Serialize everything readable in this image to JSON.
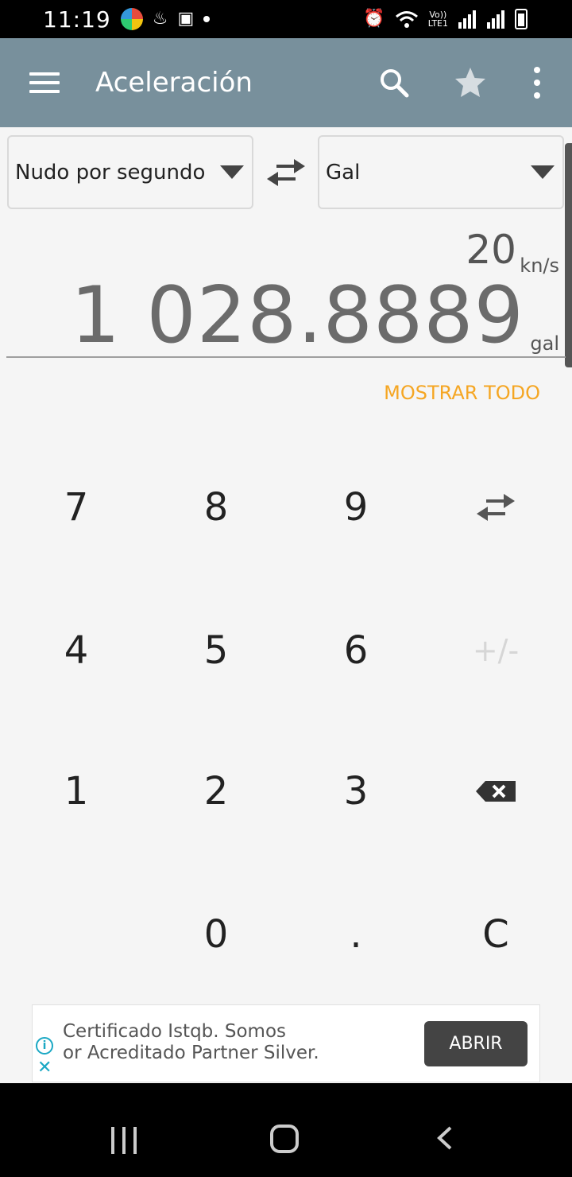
{
  "status_bar": {
    "time": "11:19",
    "icons": [
      "app-icon",
      "notification-icon",
      "image-icon",
      "dot-icon",
      "alarm-icon",
      "wifi-icon",
      "volte-icon",
      "signal-icon",
      "signal-icon",
      "battery-icon"
    ],
    "network_text_top": "Vo))",
    "network_text_bottom": "LTE1"
  },
  "app_bar": {
    "title": "Aceleración",
    "background": "#78909c"
  },
  "converter": {
    "from_unit": "Nudo por segundo",
    "to_unit": "Gal",
    "input_value": "20",
    "input_unit": "kn/s",
    "result_value": "1 028.8889",
    "result_unit": "gal",
    "show_all_label": "MOSTRAR TODO",
    "accent_color": "#f5a623"
  },
  "keypad": {
    "k7": "7",
    "k8": "8",
    "k9": "9",
    "k4": "4",
    "k5": "5",
    "k6": "6",
    "k1": "1",
    "k2": "2",
    "k3": "3",
    "k0": "0",
    "kdot": ".",
    "kclear": "C",
    "plus_minus": "+/-"
  },
  "ad": {
    "line1": "Certificado Istqb. Somos",
    "line2": "or Acreditado Partner Silver.",
    "button_label": "ABRIR",
    "info_symbol": "i",
    "close_symbol": "✕"
  }
}
